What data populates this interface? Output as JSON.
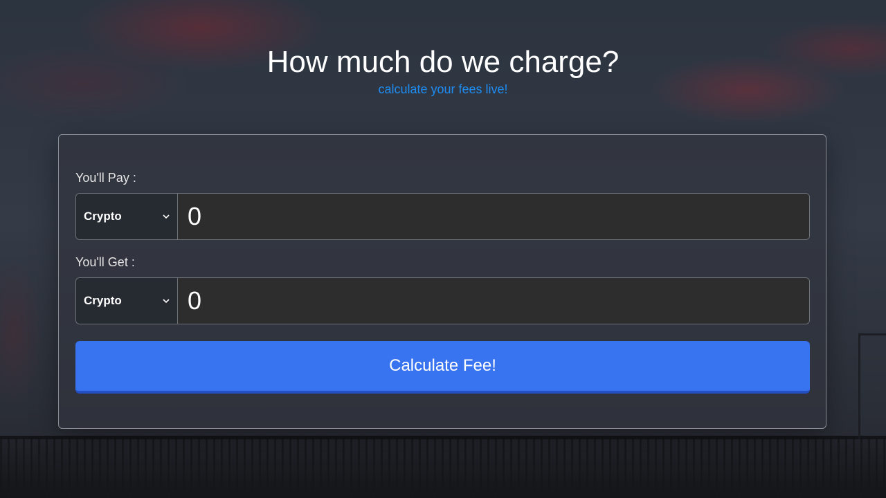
{
  "header": {
    "title": "How much do we charge?",
    "subtitle": "calculate your fees live!"
  },
  "form": {
    "pay": {
      "label": "You'll Pay :",
      "currency": "Crypto",
      "amount": "0"
    },
    "get": {
      "label": "You'll Get :",
      "currency": "Crypto",
      "amount": "0"
    },
    "button_label": "Calculate Fee!"
  },
  "icons": {
    "currency_dropdown": "chevron-down-icon"
  },
  "colors": {
    "accent": "#3873f0",
    "subtitle": "#1e8cf0",
    "card_border": "#8a8d94"
  }
}
